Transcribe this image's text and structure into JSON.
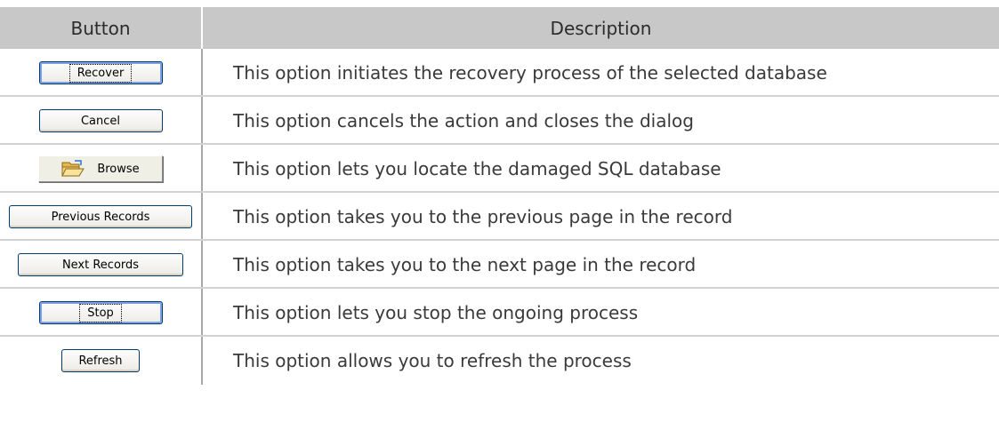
{
  "header": {
    "button_col": "Button",
    "description_col": "Description"
  },
  "rows": [
    {
      "button": "Recover",
      "description": "This option initiates the recovery process of the selected database"
    },
    {
      "button": "Cancel",
      "description": "This option cancels the action and closes the dialog"
    },
    {
      "button": "Browse",
      "description": "This option lets you locate the damaged SQL database",
      "icon": "folder-open-icon"
    },
    {
      "button": "Previous Records",
      "description": "This option takes you to the previous page in the record"
    },
    {
      "button": "Next Records",
      "description": "This option takes you to the next page in the record"
    },
    {
      "button": "Stop",
      "description": "This option lets you stop the ongoing process"
    },
    {
      "button": "Refresh",
      "description": "This option allows you to refresh the process"
    }
  ]
}
